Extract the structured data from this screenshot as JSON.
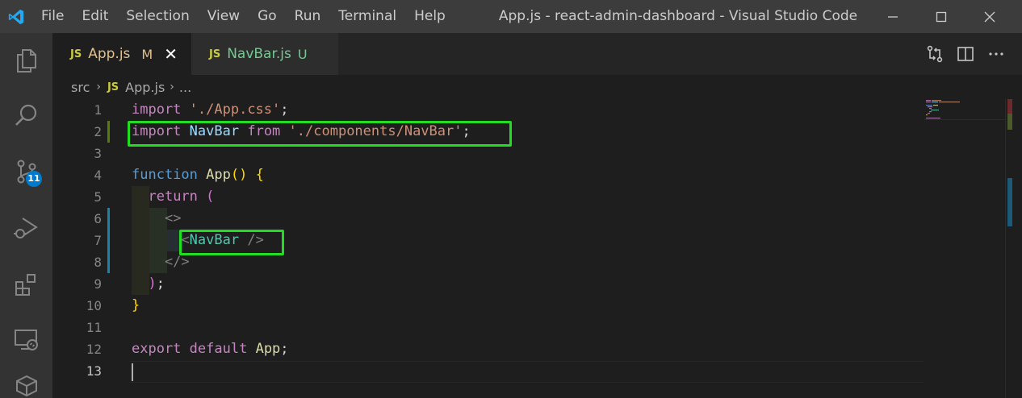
{
  "app": {
    "window_title": "App.js - react-admin-dashboard - Visual Studio Code",
    "menu": [
      "File",
      "Edit",
      "Selection",
      "View",
      "Go",
      "Run",
      "Terminal",
      "Help"
    ]
  },
  "activity_bar": {
    "scm_badge": "11"
  },
  "tabs": [
    {
      "icon_label": "JS",
      "name": "App.js",
      "status": "M",
      "active": true
    },
    {
      "icon_label": "JS",
      "name": "NavBar.js",
      "status": "U",
      "active": false
    }
  ],
  "breadcrumb": {
    "folder": "src",
    "file_icon": "JS",
    "file": "App.js",
    "more": "..."
  },
  "editor": {
    "line_numbers": [
      "1",
      "2",
      "3",
      "4",
      "5",
      "6",
      "7",
      "8",
      "9",
      "10",
      "11",
      "12",
      "13"
    ],
    "lines": [
      [
        [
          "kw",
          "import"
        ],
        [
          "p",
          " "
        ],
        [
          "str",
          "'./App.css'"
        ],
        [
          "p",
          ";"
        ]
      ],
      [
        [
          "kw",
          "import"
        ],
        [
          "p",
          " "
        ],
        [
          "id",
          "NavBar"
        ],
        [
          "p",
          " "
        ],
        [
          "kw",
          "from"
        ],
        [
          "p",
          " "
        ],
        [
          "str",
          "'./components/NavBar'"
        ],
        [
          "p",
          ";"
        ]
      ],
      [],
      [
        [
          "kwb",
          "function"
        ],
        [
          "p",
          " "
        ],
        [
          "fn",
          "App"
        ],
        [
          "br1",
          "()"
        ],
        [
          "p",
          " "
        ],
        [
          "br1",
          "{"
        ]
      ],
      [
        [
          "p",
          "  "
        ],
        [
          "kw",
          "return"
        ],
        [
          "p",
          " "
        ],
        [
          "br2",
          "("
        ]
      ],
      [
        [
          "p",
          "    "
        ],
        [
          "tag",
          "<>"
        ]
      ],
      [
        [
          "p",
          "      "
        ],
        [
          "tag",
          "<"
        ],
        [
          "comp",
          "NavBar"
        ],
        [
          "p",
          " "
        ],
        [
          "tag",
          "/>"
        ]
      ],
      [
        [
          "p",
          "    "
        ],
        [
          "tag",
          "</>"
        ]
      ],
      [
        [
          "p",
          "  "
        ],
        [
          "br2",
          ")"
        ],
        [
          "p",
          ";"
        ]
      ],
      [
        [
          "br1",
          "}"
        ]
      ],
      [],
      [
        [
          "kw",
          "export"
        ],
        [
          "p",
          " "
        ],
        [
          "kw",
          "default"
        ],
        [
          "p",
          " "
        ],
        [
          "fn",
          "App"
        ],
        [
          "p",
          ";"
        ]
      ],
      []
    ]
  },
  "colors": {
    "highlight_box": "#22dd22",
    "accent": "#007acc",
    "modified": "#e2c08d",
    "untracked": "#73c991"
  }
}
